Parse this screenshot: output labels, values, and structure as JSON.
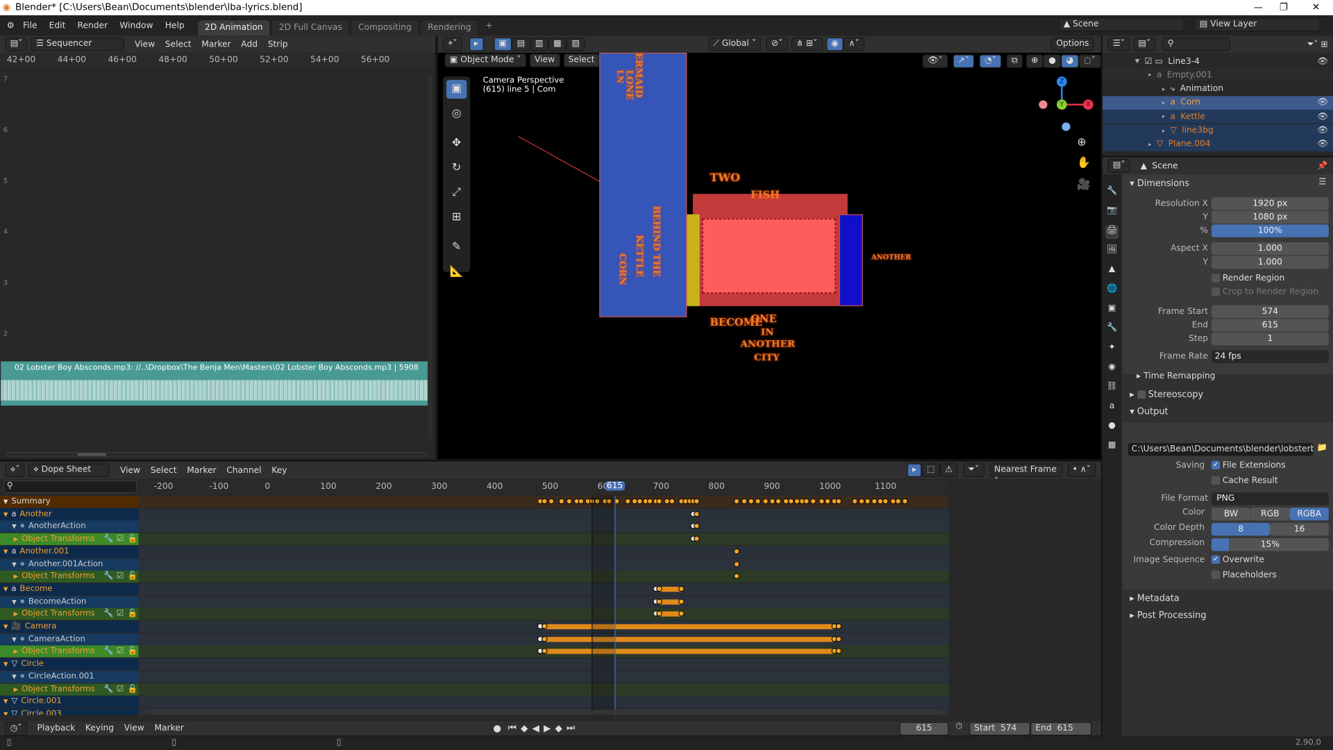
{
  "window": {
    "title": "Blender* [C:\\Users\\Bean\\Documents\\blender\\lba-lyrics.blend]",
    "minimize": "—",
    "maximize": "❐",
    "close": "✕"
  },
  "menu": [
    "File",
    "Edit",
    "Render",
    "Window",
    "Help"
  ],
  "workspaces": [
    {
      "label": "2D Animation",
      "active": true
    },
    {
      "label": "2D Full Canvas"
    },
    {
      "label": "Compositing"
    },
    {
      "label": "Rendering"
    }
  ],
  "add_workspace": "+",
  "scene": "Scene",
  "view_layer": "View Layer",
  "sequencer": {
    "editor": "Sequencer",
    "menus": [
      "View",
      "Select",
      "Marker",
      "Add",
      "Strip"
    ],
    "ruler": [
      "42+00",
      "44+00",
      "46+00",
      "48+00",
      "50+00",
      "52+00",
      "54+00",
      "56+00"
    ],
    "channels": [
      "7",
      "6",
      "5",
      "4",
      "3",
      "2"
    ],
    "strip": "02 Lobster Boy Absconds.mp3: //..\\Dropbox\\The Benja Men\\Masters\\02 Lobster Boy Absconds.mp3 | 5908",
    "strip_color": "#4a9a94"
  },
  "viewport": {
    "mode": "Object Mode",
    "menus": [
      "View",
      "Select",
      "Add",
      "Object"
    ],
    "orientation": "Global",
    "options": "Options",
    "overlay_title": "Camera Perspective",
    "overlay_sub": "(615) line 5 | Com",
    "gizmo": {
      "z": "Z",
      "y": "Y",
      "x": "X"
    },
    "lyrics": {
      "a": "ERMAID",
      "b": "LONE",
      "c": "LN",
      "d": "BEHIND THE",
      "e": "KETTLE",
      "f": "CORN",
      "g": "TWO",
      "h": "FISH",
      "i": "BECOME",
      "j": "ONE",
      "k": "IN",
      "l": "ANOTHER",
      "m": "CITY",
      "n": "ANOTHER"
    }
  },
  "outliner": {
    "items": [
      {
        "label": "Line3-4",
        "depth": 0,
        "color": "#ddd",
        "eye": true
      },
      {
        "label": "Empty.001",
        "depth": 1,
        "color": "#888"
      },
      {
        "label": "Animation",
        "depth": 2,
        "color": "#ddd"
      },
      {
        "label": "Corn",
        "depth": 2,
        "color": "#f0a030",
        "selected": true,
        "eye": true
      },
      {
        "label": "Kettle",
        "depth": 2,
        "color": "#e87d2a",
        "eye": true
      },
      {
        "label": "line3bg",
        "depth": 2,
        "color": "#e87d2a",
        "eye": true
      },
      {
        "label": "Plane.004",
        "depth": 1,
        "color": "#e87d2a",
        "eye": true
      }
    ]
  },
  "properties": {
    "context": "Scene",
    "dimensions": {
      "title": "Dimensions",
      "res_x_label": "Resolution X",
      "res_x": "1920 px",
      "res_y_label": "Y",
      "res_y": "1080 px",
      "pct_label": "%",
      "pct": "100%",
      "aspect_x_label": "Aspect X",
      "aspect_x": "1.000",
      "aspect_y_label": "Y",
      "aspect_y": "1.000",
      "render_region": "Render Region",
      "crop": "Crop to Render Region",
      "frame_start_label": "Frame Start",
      "frame_start": "574",
      "end_label": "End",
      "end": "615",
      "step_label": "Step",
      "step": "1",
      "frame_rate_label": "Frame Rate",
      "frame_rate": "24 fps",
      "time_remapping": "Time Remapping"
    },
    "stereoscopy": "Stereoscopy",
    "output": {
      "title": "Output",
      "path": "C:\\Users\\Bean\\Documents\\blender\\lobsterboyscen...",
      "saving_label": "Saving",
      "file_ext": "File Extensions",
      "cache": "Cache Result",
      "format_label": "File Format",
      "format": "PNG",
      "color_label": "Color",
      "color_opts": [
        "BW",
        "RGB",
        "RGBA"
      ],
      "color_selected": "RGBA",
      "depth_label": "Color Depth",
      "depth_opts": [
        "8",
        "16"
      ],
      "depth_selected": "8",
      "compression_label": "Compression",
      "compression": "15%",
      "compression_value": 15,
      "seq_label": "Image Sequence",
      "overwrite": "Overwrite",
      "placeholders": "Placeholders"
    },
    "metadata": "Metadata",
    "post": "Post Processing"
  },
  "dopesheet": {
    "editor": "Dope Sheet",
    "menus": [
      "View",
      "Select",
      "Marker",
      "Channel",
      "Key"
    ],
    "snap": "Nearest Frame",
    "ticks": [
      -200,
      -100,
      0,
      100,
      200,
      300,
      400,
      500,
      600,
      700,
      800,
      900,
      1000,
      1100
    ],
    "current_frame": 615,
    "frame_start": 574,
    "channels": [
      {
        "label": "Summary",
        "kind": "summary"
      },
      {
        "label": "Another",
        "kind": "object",
        "icon": "a",
        "keys": [
          758,
          765
        ]
      },
      {
        "label": "AnotherAction",
        "kind": "action",
        "keys": [
          758,
          765
        ]
      },
      {
        "label": "Object Transforms",
        "kind": "group",
        "sel": true,
        "keys": [
          758,
          765
        ]
      },
      {
        "label": "Another.001",
        "kind": "object",
        "icon": "a",
        "keys": [
          836
        ]
      },
      {
        "label": "Another.001Action",
        "kind": "action",
        "keys": [
          836
        ]
      },
      {
        "label": "Object Transforms",
        "kind": "group",
        "keys": [
          836
        ]
      },
      {
        "label": "Become",
        "kind": "object",
        "icon": "a",
        "keys": [
          690,
          697,
          737
        ],
        "hold": [
          697,
          737
        ]
      },
      {
        "label": "BecomeAction",
        "kind": "action",
        "keys": [
          690,
          697,
          737
        ],
        "hold": [
          697,
          737
        ]
      },
      {
        "label": "Object Transforms",
        "kind": "group",
        "keys": [
          690,
          697,
          737
        ],
        "hold": [
          697,
          737
        ]
      },
      {
        "label": "Camera",
        "kind": "object",
        "icon": "cam",
        "keys": [
          482,
          490,
          1012,
          1020
        ],
        "hold": [
          490,
          1012
        ]
      },
      {
        "label": "CameraAction",
        "kind": "action",
        "keys": [
          482,
          490,
          1012,
          1020
        ],
        "hold": [
          490,
          1012
        ]
      },
      {
        "label": "Object Transforms",
        "kind": "group",
        "sel": true,
        "keys": [
          482,
          490,
          1012,
          1020
        ],
        "hold": [
          490,
          1012
        ]
      },
      {
        "label": "Circle",
        "kind": "object",
        "icon": "tri"
      },
      {
        "label": "CircleAction.001",
        "kind": "action"
      },
      {
        "label": "Object Transforms",
        "kind": "group"
      },
      {
        "label": "Circle.001",
        "kind": "object",
        "icon": "tri"
      },
      {
        "label": "Circle.003",
        "kind": "object",
        "icon": "tri"
      }
    ],
    "summary_keys": [
      482,
      490,
      502,
      520,
      535,
      548,
      556,
      568,
      575,
      585,
      598,
      606,
      620,
      640,
      652,
      662,
      672,
      680,
      690,
      697,
      710,
      720,
      737,
      745,
      752,
      758,
      765,
      836,
      850,
      862,
      875,
      888,
      900,
      912,
      925,
      935,
      945,
      955,
      962,
      975,
      990,
      1000,
      1012,
      1020,
      1050,
      1062,
      1072,
      1085,
      1095,
      1105,
      1118,
      1128,
      1140
    ]
  },
  "timeline": {
    "menus": [
      "Playback",
      "Keying",
      "View",
      "Marker"
    ],
    "frame": "615",
    "start_label": "Start",
    "start": "574",
    "end_label": "End",
    "end": "615"
  },
  "status": {
    "version": "2.90.0"
  }
}
